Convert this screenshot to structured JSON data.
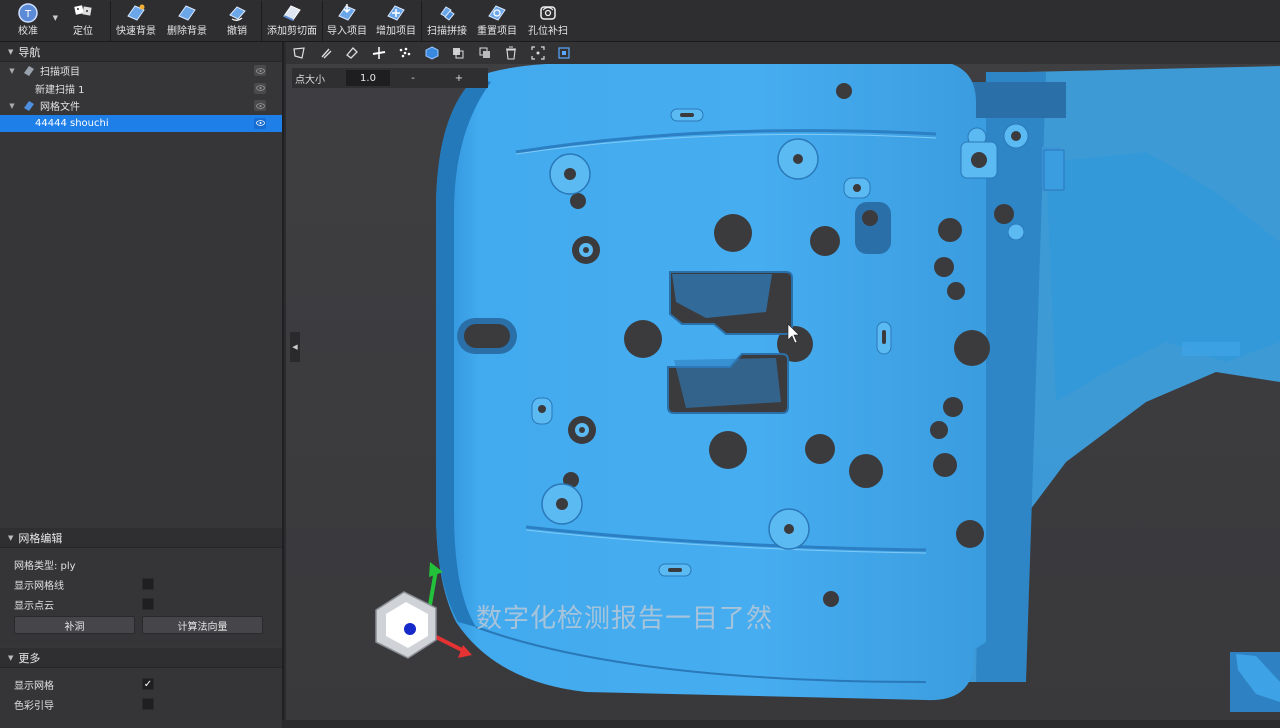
{
  "toolbar": {
    "items": [
      {
        "label": "校准",
        "icon": "calibrate-icon"
      },
      {
        "label": "定位",
        "icon": "locate-icon"
      },
      {
        "label": "快速背景",
        "icon": "quick-background-icon"
      },
      {
        "label": "删除背景",
        "icon": "delete-background-icon"
      },
      {
        "label": "撤销",
        "icon": "undo-icon"
      },
      {
        "label": "添加剪切面",
        "icon": "add-clip-plane-icon"
      },
      {
        "label": "导入项目",
        "icon": "import-project-icon"
      },
      {
        "label": "增加项目",
        "icon": "add-project-icon"
      },
      {
        "label": "扫描拼接",
        "icon": "scan-stitch-icon"
      },
      {
        "label": "重置项目",
        "icon": "reset-project-icon"
      },
      {
        "label": "孔位补扫",
        "icon": "hole-rescan-icon"
      }
    ]
  },
  "nav": {
    "title": "导航",
    "tree": [
      {
        "label": "扫描项目",
        "level": 1,
        "selected": false
      },
      {
        "label": "新建扫描 1",
        "level": 2,
        "selected": false
      },
      {
        "label": "网格文件",
        "level": 1,
        "selected": false
      },
      {
        "label": "44444 shouchi",
        "level": 2,
        "selected": true
      }
    ]
  },
  "mesh_edit": {
    "title": "网格编辑",
    "type_label": "网格类型: ply",
    "show_wireframe_label": "显示网格线",
    "show_wireframe": false,
    "show_pointcloud_label": "显示点云",
    "show_pointcloud": false,
    "fill_holes_label": "补洞",
    "compute_normals_label": "计算法向量"
  },
  "more": {
    "title": "更多",
    "show_mesh_label": "显示网格",
    "show_mesh": true,
    "color_guide_label": "色彩引导",
    "color_guide": false
  },
  "viewport": {
    "point_size_label": "点大小",
    "point_size_value": "1.0",
    "minus_label": "-",
    "plus_label": "+",
    "subtitle": "数字化检测报告一目了然",
    "colors": {
      "mesh": "#3fa9ec",
      "mesh_dark": "#2a78b8",
      "background": "#3b3b3e",
      "accent": "#1f7fe8"
    }
  }
}
